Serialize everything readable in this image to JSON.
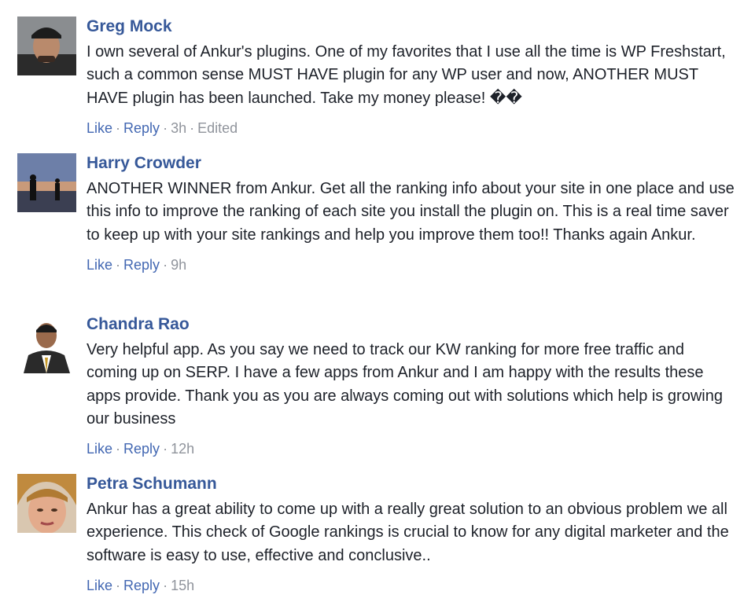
{
  "comments": [
    {
      "author": "Greg Mock",
      "text": "I own several of Ankur's plugins. One of my favorites that I use all the time is WP Freshstart, such a common sense MUST HAVE plugin for any WP user and now, ANOTHER MUST HAVE plugin has been launched. Take my money please! ��",
      "like_label": "Like",
      "reply_label": "Reply",
      "time": "3h",
      "edited": "Edited"
    },
    {
      "author": "Harry Crowder",
      "text": "ANOTHER WINNER from Ankur. Get all the ranking info about your site in one place and use this info to improve the ranking of each site you install the plugin on. This is a real time saver to keep up with your site rankings and help you improve them too!! Thanks again Ankur.",
      "like_label": "Like",
      "reply_label": "Reply",
      "time": "9h"
    },
    {
      "author": "Chandra Rao",
      "text": "Very helpful app. As you say we need to track our KW ranking for more free traffic and coming up on SERP. I have a few apps from Ankur and I am happy with the results these apps provide. Thank you as you are always coming out with solutions which help is growing our business",
      "like_label": "Like",
      "reply_label": "Reply",
      "time": "12h"
    },
    {
      "author": "Petra Schumann",
      "text": "Ankur has a great ability to come up with a really great solution to an obvious problem we all experience. This check of Google rankings is crucial to know for any digital marketer and the software is easy to use, effective and conclusive..",
      "like_label": "Like",
      "reply_label": "Reply",
      "time": "15h"
    }
  ],
  "colors": {
    "author": "#365899",
    "link": "#4267b2",
    "meta": "#90949c",
    "text": "#1d2129"
  }
}
